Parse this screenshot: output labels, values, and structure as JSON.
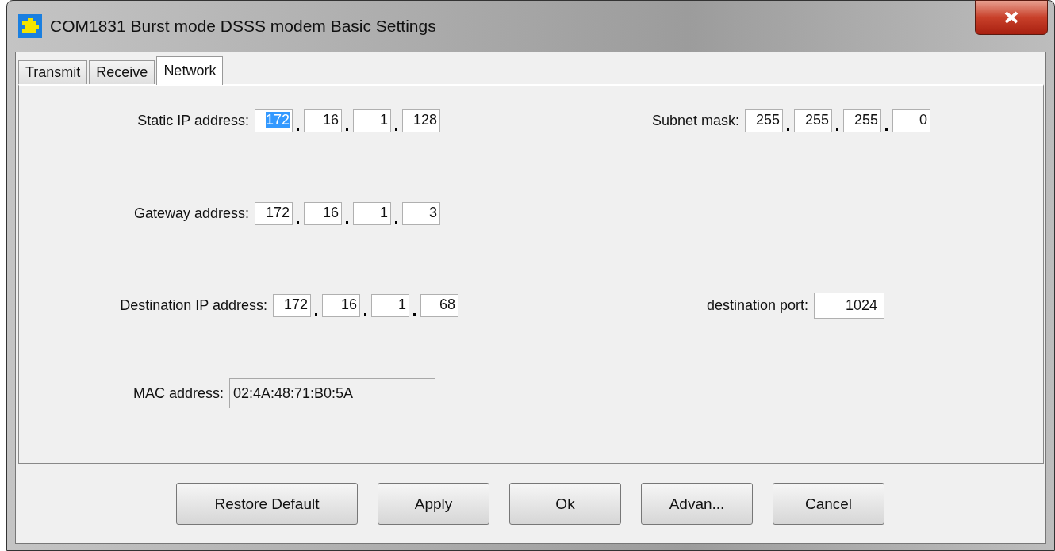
{
  "window": {
    "title": "COM1831 Burst mode DSSS modem Basic Settings"
  },
  "tabs": [
    {
      "label": "Transmit",
      "selected": false
    },
    {
      "label": "Receive",
      "selected": false
    },
    {
      "label": "Network",
      "selected": true
    }
  ],
  "rows": [
    {
      "fields": [
        {
          "kind": "ip",
          "label": "Static IP address:",
          "octets": [
            {
              "value": "172",
              "selected": true
            },
            {
              "value": "16",
              "selected": false
            },
            {
              "value": "1",
              "selected": false
            },
            {
              "value": "128",
              "selected": false
            }
          ]
        },
        {
          "kind": "ip",
          "label": "Subnet mask:",
          "octets": [
            {
              "value": "255",
              "selected": false
            },
            {
              "value": "255",
              "selected": false
            },
            {
              "value": "255",
              "selected": false
            },
            {
              "value": "0",
              "selected": false
            }
          ]
        }
      ]
    },
    {
      "fields": [
        {
          "kind": "ip",
          "label": "Gateway address:",
          "octets": [
            {
              "value": "172",
              "selected": false
            },
            {
              "value": "16",
              "selected": false
            },
            {
              "value": "1",
              "selected": false
            },
            {
              "value": "3",
              "selected": false
            }
          ]
        }
      ]
    },
    {
      "fields": [
        {
          "kind": "ip",
          "label": "Destination IP address:",
          "octets": [
            {
              "value": "172",
              "selected": false
            },
            {
              "value": "16",
              "selected": false
            },
            {
              "value": "1",
              "selected": false
            },
            {
              "value": "68",
              "selected": false
            }
          ]
        },
        {
          "kind": "number",
          "label": "destination port:",
          "value": "1024"
        }
      ]
    },
    {
      "fields": [
        {
          "kind": "readonly",
          "label": "MAC address:",
          "value": "02:4A:48:71:B0:5A"
        }
      ]
    }
  ],
  "buttons": [
    "Restore Default",
    "Apply",
    "Ok",
    "Advan...",
    "Cancel"
  ]
}
